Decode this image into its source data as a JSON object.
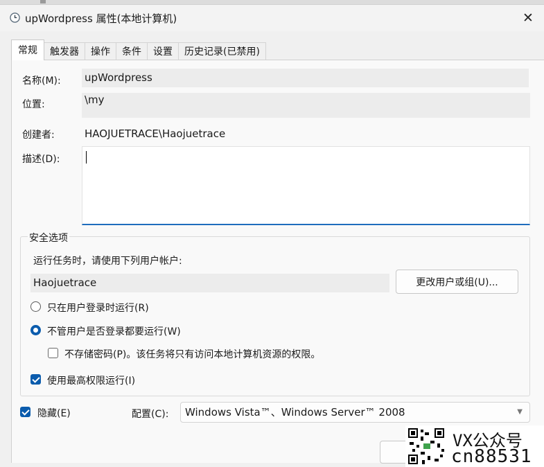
{
  "window": {
    "title": "upWordpress 属性(本地计算机)",
    "icon": "clock-icon",
    "close": "✕"
  },
  "tabs": [
    "常规",
    "触发器",
    "操作",
    "条件",
    "设置",
    "历史记录(已禁用)"
  ],
  "general": {
    "name_label": "名称(M):",
    "name_value": "upWordpress",
    "location_label": "位置:",
    "location_value": "\\my",
    "author_label": "创建者:",
    "author_value": "HAOJUETRACE\\Haojuetrace",
    "desc_label": "描述(D):",
    "desc_value": ""
  },
  "security": {
    "title": "安全选项",
    "run_as_text": "运行任务时，请使用下列用户帐户:",
    "account": "Haojuetrace",
    "change_button": "更改用户或组(U)...",
    "radio_logged_on": "只在用户登录时运行(R)",
    "radio_always": "不管用户是否登录都要运行(W)",
    "no_store_password": "不存储密码(P)。该任务将只有访问本地计算机资源的权限。",
    "highest_privileges": "使用最高权限运行(I)"
  },
  "footer": {
    "hidden_label": "隐藏(E)",
    "config_label": "配置(C):",
    "config_value": "Windows Vista™、Windows Server™ 2008"
  },
  "watermark": {
    "line1": "VX公众号",
    "line2": "cn88531"
  },
  "colors": {
    "accent": "#0b5cad",
    "focus_border": "#1f6dbd"
  }
}
